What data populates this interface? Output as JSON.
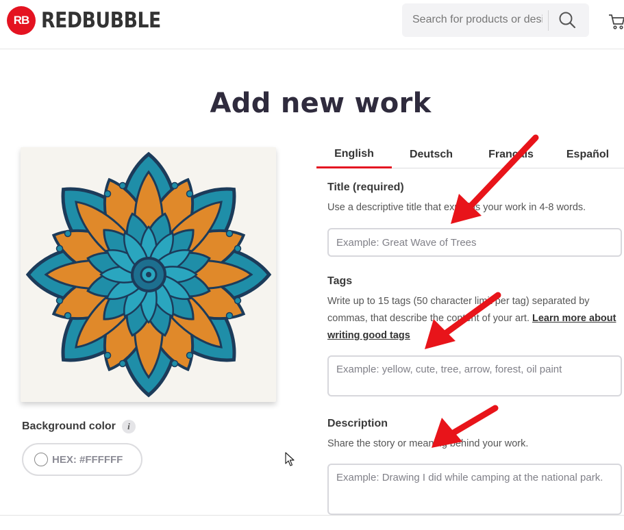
{
  "header": {
    "logo_badge": "RB",
    "logo_text": "REDBUBBLE",
    "search_placeholder": "Search for products or designs"
  },
  "page_title": "Add new work",
  "artwork": {
    "background_label": "Background color",
    "info_icon_glyph": "i",
    "hex_value": "HEX: #FFFFFF"
  },
  "tabs": [
    {
      "label": "English",
      "active": true
    },
    {
      "label": "Deutsch",
      "active": false
    },
    {
      "label": "Français",
      "active": false
    },
    {
      "label": "Español",
      "active": false
    }
  ],
  "form": {
    "title": {
      "label": "Title (required)",
      "help": "Use a descriptive title that explains your work in 4-8 words.",
      "placeholder": "Example: Great Wave of Trees"
    },
    "tags": {
      "label": "Tags",
      "help": "Write up to 15 tags (50 character limit per tag) separated by commas, that describe the content of your art.",
      "help_link": "Learn more about writing good tags",
      "placeholder": "Example: yellow, cute, tree, arrow, forest, oil paint"
    },
    "description": {
      "label": "Description",
      "help": "Share the story or meaning behind your work.",
      "placeholder": "Example: Drawing I did while camping at the national park."
    }
  },
  "colors": {
    "brand": "#e41321",
    "annotation_arrow": "#e8141a",
    "mandala_teal": "#1f8ea8",
    "mandala_orange": "#e0892a",
    "mandala_navy": "#1c3b5a"
  },
  "icons": [
    "search-icon",
    "cart-icon",
    "info-icon",
    "mouse-cursor-icon",
    "annotation-arrow"
  ]
}
